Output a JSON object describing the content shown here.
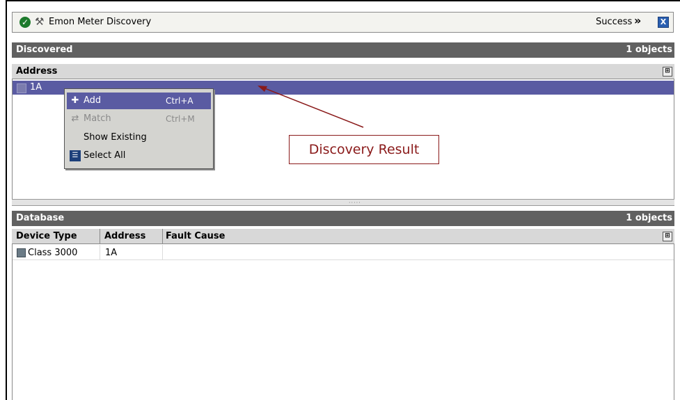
{
  "job": {
    "title": "Emon Meter Discovery",
    "status": "Success",
    "more": "»",
    "close": "X"
  },
  "discovered": {
    "title": "Discovered",
    "count": "1 objects",
    "columns": [
      "Address"
    ],
    "rows": [
      {
        "address": "1A"
      }
    ]
  },
  "context_menu": {
    "items": [
      {
        "label": "Add",
        "shortcut": "Ctrl+A",
        "icon": "add-icon"
      },
      {
        "label": "Match",
        "shortcut": "Ctrl+M",
        "icon": "match-icon"
      },
      {
        "label": "Show Existing",
        "shortcut": "",
        "icon": ""
      },
      {
        "label": "Select All",
        "shortcut": "",
        "icon": "select-all-icon"
      }
    ]
  },
  "database": {
    "title": "Database",
    "count": "1 objects",
    "columns": [
      "Device Type",
      "Address",
      "Fault Cause"
    ],
    "rows": [
      {
        "device_type": "Class 3000",
        "address": "1A",
        "fault_cause": ""
      }
    ]
  },
  "annotation": {
    "label": "Discovery Result"
  },
  "colors": {
    "selection": "#5a5ba2",
    "pane_header": "#616161",
    "annotation": "#8a1a1a"
  }
}
